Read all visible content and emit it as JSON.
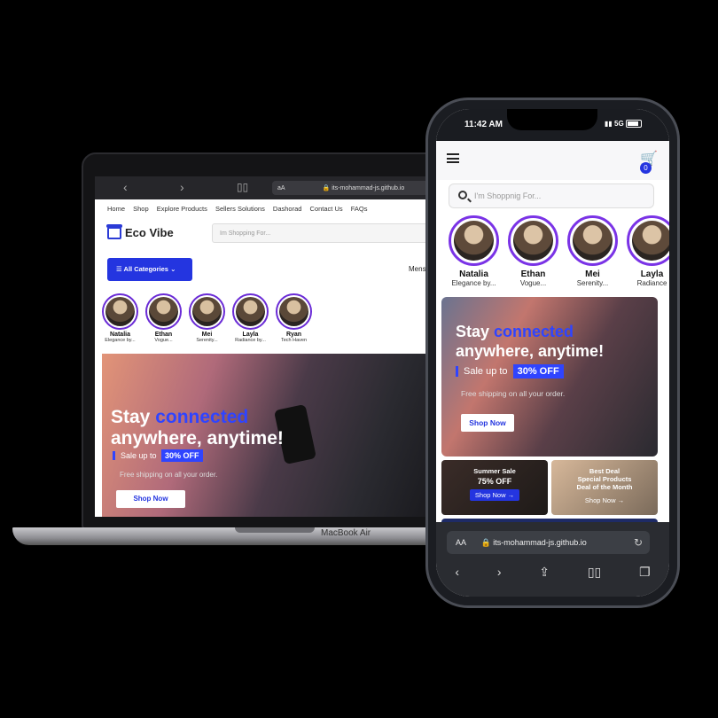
{
  "laptop": {
    "browser": {
      "aa": "aA",
      "url": "its-mohammad-js.github.io"
    },
    "nav": [
      "Home",
      "Shop",
      "Explore Products",
      "Sellers Solutions",
      "Dashorad",
      "Contact Us",
      "FAQs"
    ],
    "logo": "Eco Vibe",
    "search_placeholder": "Im Shopping For...",
    "categories_label": "All Categories",
    "mens_label": "Mens",
    "stories": [
      {
        "name": "Natalia",
        "sub": "Elegance by..."
      },
      {
        "name": "Ethan",
        "sub": "Vogue..."
      },
      {
        "name": "Mei",
        "sub": "Serenity..."
      },
      {
        "name": "Layla",
        "sub": "Radiance by..."
      },
      {
        "name": "Ryan",
        "sub": "Tech Haven"
      }
    ],
    "hero": {
      "title_pre": "Stay ",
      "title_accent": "connected",
      "title_line2": "anywhere, anytime!",
      "sale_text": "Sale up to",
      "sale_badge": "30% OFF",
      "free_text": "Free shipping on all your order.",
      "cta": "Shop Now"
    },
    "model_label": "MacBook Air"
  },
  "phone": {
    "time": "11:42 AM",
    "signal": "5G",
    "cart_count": "0",
    "search_placeholder": "I'm Shoppnig For...",
    "stories": [
      {
        "name": "Natalia",
        "sub": "Elegance by..."
      },
      {
        "name": "Ethan",
        "sub": "Vogue..."
      },
      {
        "name": "Mei",
        "sub": "Serenity..."
      },
      {
        "name": "Layla",
        "sub": "Radiance"
      }
    ],
    "hero": {
      "title_pre": "Stay ",
      "title_accent": "connected",
      "title_line2": "anywhere, anytime!",
      "sale_text": "Sale up to",
      "sale_badge": "30% OFF",
      "free_text": "Free shipping on all your order.",
      "cta": "Shop Now"
    },
    "cards": [
      {
        "title": "Summer Sale",
        "value": "75% OFF",
        "cta": "Shop Now"
      },
      {
        "title": "Best Deal\nSpecial Products\nDeal of the Month",
        "value": "",
        "cta": "Shop Now"
      }
    ],
    "browser": {
      "aa": "AA",
      "url": "its-mohammad-js.github.io"
    }
  },
  "colors": {
    "accent": "#2f44ff",
    "brand_button": "#2435e0",
    "story_ring": "#7a33e6"
  }
}
